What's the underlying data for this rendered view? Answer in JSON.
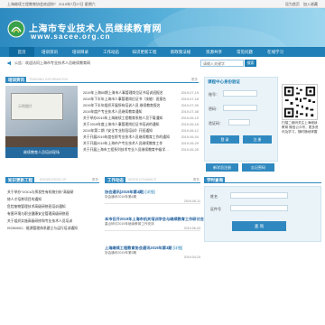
{
  "topbar": {
    "welcome": "上海继续工程教育协会欢迎你！ 2019年7月27日 星期六",
    "links": [
      "设为首页",
      "加入收藏"
    ]
  },
  "header": {
    "title": "上海市专业技术人员继续教育网",
    "url": "www.sacee.org.cn"
  },
  "nav": {
    "items": [
      "首页",
      "培训资讯",
      "培训目录",
      "工作动态",
      "知识更新工程",
      "新政策法规",
      "资源共享",
      "常见问题",
      "在线学习"
    ],
    "active_index": 0
  },
  "notice": {
    "icon": "speaker-icon",
    "text": "公告：欢迎访问上海市专业技术人员继续教育网"
  },
  "search": {
    "placeholder": "请输入关键字",
    "button_label": "搜索"
  },
  "training": {
    "title": "培训资讯",
    "title_en": "TRAINING INFORMATION",
    "more": "更多",
    "image_screen_text": "示例图片",
    "image_caption": "继续教育人员培训现场",
    "items": [
      {
        "title": "2019年上海50期上海市人事管理岗位证书培训班报名",
        "date": "2019-07-19"
      },
      {
        "title": "2019年下半年上海市人事管理岗位证书（技能）班报名",
        "date": "2019-07-18"
      },
      {
        "title": "2019年下半年组织开展所有培训人员 继续教育报名",
        "date": "2019-07-09"
      },
      {
        "title": "2019年度产专业技术人员继续教育通知",
        "date": "2019-07-08"
      },
      {
        "title": "关于举办2019年上海继续工程教育系统人员下载通知",
        "date": "2019-06-19"
      },
      {
        "title": "关于2019年度上海市人事管理岗位证书培训的通知",
        "date": "2019-06-18"
      },
      {
        "title": "2019年第二期《安全专业阶段培训》开班通知",
        "date": "2019-06-12"
      },
      {
        "title": "关于开展2019年度在职专业技术人员继续教育工作的通知",
        "date": "2019-06-04"
      },
      {
        "title": "关于开展2019年上海市产专业技术人员继续教育工作",
        "date": "2019-05-29"
      },
      {
        "title": "关于开展上海市工程系列技术专业人员继续教育中级学…",
        "date": "2019-05-25"
      }
    ]
  },
  "login": {
    "title": "课程中心身份验证",
    "account_label": "账号：",
    "password_label": "密码：",
    "code_label": "验证码：",
    "login_button": "登 录",
    "register_button": "注 册"
  },
  "qr": {
    "caption": "扫描二维码关注上海继续教育 微信公众号，更多资讯及学习，随时随地掌握"
  },
  "side_buttons": [
    "新学员注册",
    "忘记密码"
  ],
  "knowledge": {
    "title": "知识更新工程",
    "title_en": "KNOWLEDGE UP",
    "more": "更多",
    "items": [
      "关于举办\"VOCs与挥发性有机物分析\"高级研",
      "修人才培养项目的通知",
      "危险废物管理技术高级研修班培训通知",
      "有害环境与职业健康安全管理高级研修班",
      "关于组织实施高级研修和专业技术人员培训",
      "ISO50001：能源管理体系建立与运行培训通知"
    ]
  },
  "work": {
    "title": "工作动态",
    "title_en": "WORK DYNAMICS",
    "more": "更多",
    "items": [
      {
        "headline": "协会通讯(2019年第4期)",
        "more": "[详细]",
        "summary": "协会通讯2019年第4期",
        "date": "2019-06-11"
      },
      {
        "headline": "本市召开2019年上海市机关培训学会与继续教育工作研讨会",
        "more": "",
        "summary": "重点研讨2019年继续教育工作安排",
        "date": "2019-06-03"
      },
      {
        "headline": "上海继续工程教育协会通讯2019年第3期",
        "more": "[详细]",
        "summary": "协会通讯2019年第3期",
        "date": "2019-04-24"
      }
    ]
  },
  "help": {
    "title": "学时查询",
    "field_label": "姓名",
    "id_label": "证件号",
    "query_button": "查 询"
  },
  "colors": {
    "brand": "#1f7fb6",
    "accent": "#2f89c0",
    "header_light": "#8fd0ec"
  }
}
